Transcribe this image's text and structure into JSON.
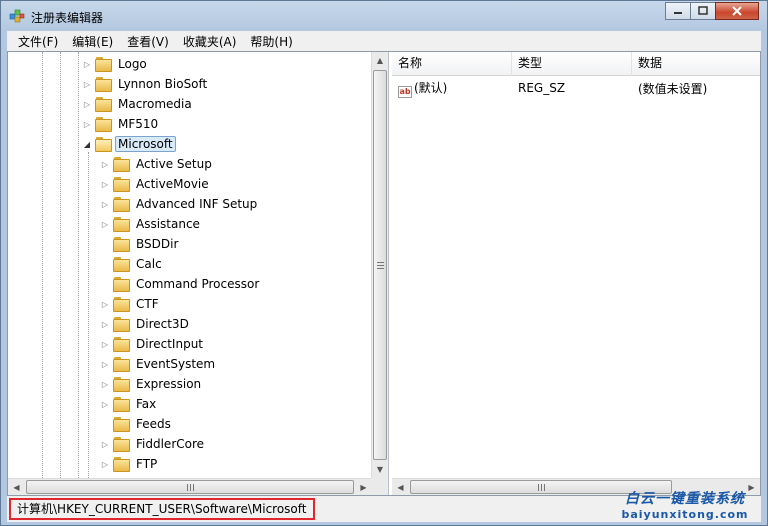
{
  "window": {
    "title": "注册表编辑器",
    "buttons": [
      "minimize",
      "maximize",
      "close"
    ]
  },
  "menu": [
    "文件(F)",
    "编辑(E)",
    "查看(V)",
    "收藏夹(A)",
    "帮助(H)"
  ],
  "tree": {
    "parent_items": [
      {
        "label": "Logo"
      },
      {
        "label": "Lynnon BioSoft"
      },
      {
        "label": "Macromedia"
      },
      {
        "label": "MF510"
      },
      {
        "label": "Microsoft",
        "selected": true,
        "expanded": true
      }
    ],
    "child_items": [
      {
        "label": "Active Setup",
        "has_children": true
      },
      {
        "label": "ActiveMovie",
        "has_children": true
      },
      {
        "label": "Advanced INF Setup",
        "has_children": true
      },
      {
        "label": "Assistance",
        "has_children": true
      },
      {
        "label": "BSDDir",
        "has_children": false
      },
      {
        "label": "Calc",
        "has_children": false
      },
      {
        "label": "Command Processor",
        "has_children": false
      },
      {
        "label": "CTF",
        "has_children": true
      },
      {
        "label": "Direct3D",
        "has_children": true
      },
      {
        "label": "DirectInput",
        "has_children": true
      },
      {
        "label": "EventSystem",
        "has_children": true
      },
      {
        "label": "Expression",
        "has_children": true
      },
      {
        "label": "Fax",
        "has_children": true
      },
      {
        "label": "Feeds",
        "has_children": false
      },
      {
        "label": "FiddlerCore",
        "has_children": true
      },
      {
        "label": "FTP",
        "has_children": true
      }
    ]
  },
  "list": {
    "columns": [
      "名称",
      "类型",
      "数据"
    ],
    "rows": [
      {
        "name": "(默认)",
        "type": "REG_SZ",
        "data": "(数值未设置)"
      }
    ]
  },
  "status": {
    "path": "计算机\\HKEY_CURRENT_USER\\Software\\Microsoft"
  },
  "watermark": {
    "line1": "白云一键重装系统",
    "line2": "baiyunxitong.com"
  },
  "colors": {
    "status_highlight": "#e0262e",
    "selection": "#d9eaf9",
    "watermark": "#1a58a8"
  }
}
